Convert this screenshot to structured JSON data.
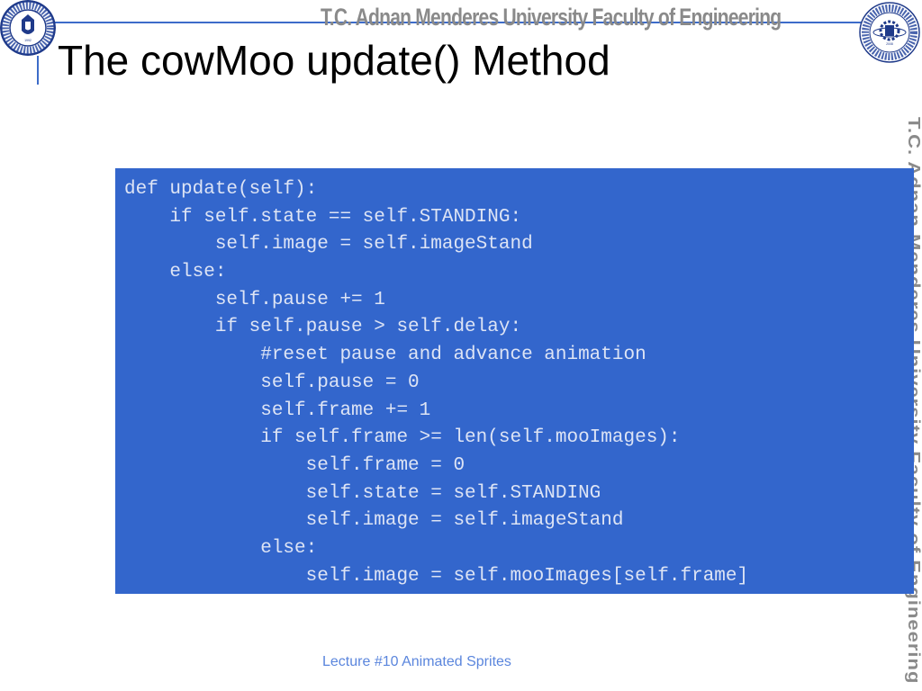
{
  "header": {
    "banner_text": "T.C.   Adnan Menderes University   Faculty of Engineering",
    "side_banner_text": "T.C.   Adnan Menderes University   Faculty of Engineering",
    "left_logo": {
      "icon": "university-seal-icon",
      "text": "ADNAN MENDERES ÜNİVERSİTESİ",
      "year": "1992"
    },
    "right_logo": {
      "icon": "engineering-faculty-seal-icon",
      "text": "ADNAN MENDERES UNIVERSITY ENGINEERING FACULTY",
      "year": "2008"
    }
  },
  "slide": {
    "title": "The cowMoo update() Method",
    "code_lines": [
      "def update(self):",
      "    if self.state == self.STANDING:",
      "        self.image = self.imageStand",
      "    else:",
      "        self.pause += 1",
      "        if self.pause > self.delay:",
      "            #reset pause and advance animation",
      "            self.pause = 0",
      "            self.frame += 1",
      "            if self.frame >= len(self.mooImages):",
      "                self.frame = 0",
      "                self.state = self.STANDING",
      "                self.image = self.imageStand",
      "            else:",
      "                self.image = self.mooImages[self.frame]"
    ]
  },
  "footer": {
    "text": "Lecture #10 Animated Sprites"
  },
  "colors": {
    "accent_blue": "#3d6cc9",
    "code_background": "#3366cc",
    "code_text": "#dde4f5",
    "footer_text": "#5b86dd",
    "banner_gray": "#8a8a8a"
  }
}
